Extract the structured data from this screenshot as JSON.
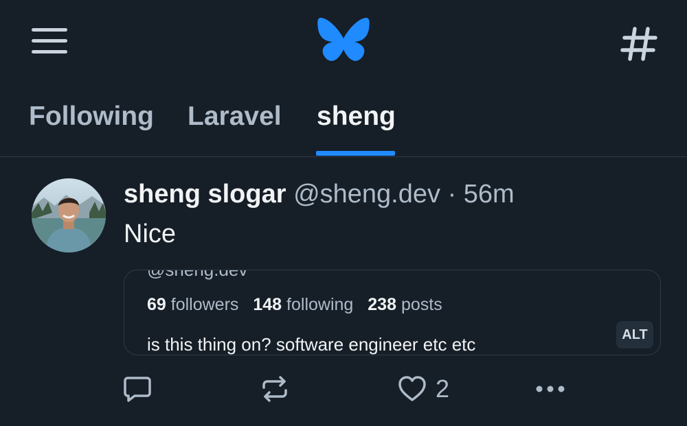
{
  "header": {
    "menu_icon": "hamburger-menu-icon",
    "logo_icon": "butterfly-logo-icon",
    "feeds_icon": "hashtag-icon"
  },
  "tabs": [
    {
      "label": "Following",
      "active": false
    },
    {
      "label": "Laravel",
      "active": false
    },
    {
      "label": "sheng",
      "active": true
    }
  ],
  "post": {
    "author_name": "sheng slogar",
    "author_handle": "@sheng.dev",
    "separator": "·",
    "time": "56m",
    "text": "Nice",
    "embed": {
      "handle": "@sheng.dev",
      "stats": [
        {
          "count": "69",
          "label": "followers"
        },
        {
          "count": "148",
          "label": "following"
        },
        {
          "count": "238",
          "label": "posts"
        }
      ],
      "bio": "is this thing on? software engineer etc etc",
      "alt_label": "ALT"
    },
    "actions": {
      "reply_icon": "reply-icon",
      "repost_icon": "repost-icon",
      "like_icon": "heart-icon",
      "like_count": "2",
      "more_icon": "more-options-icon"
    }
  },
  "colors": {
    "background": "#161e27",
    "accent": "#208bfe",
    "muted_text": "#aebbc9",
    "primary_text": "#f1f3f5"
  }
}
